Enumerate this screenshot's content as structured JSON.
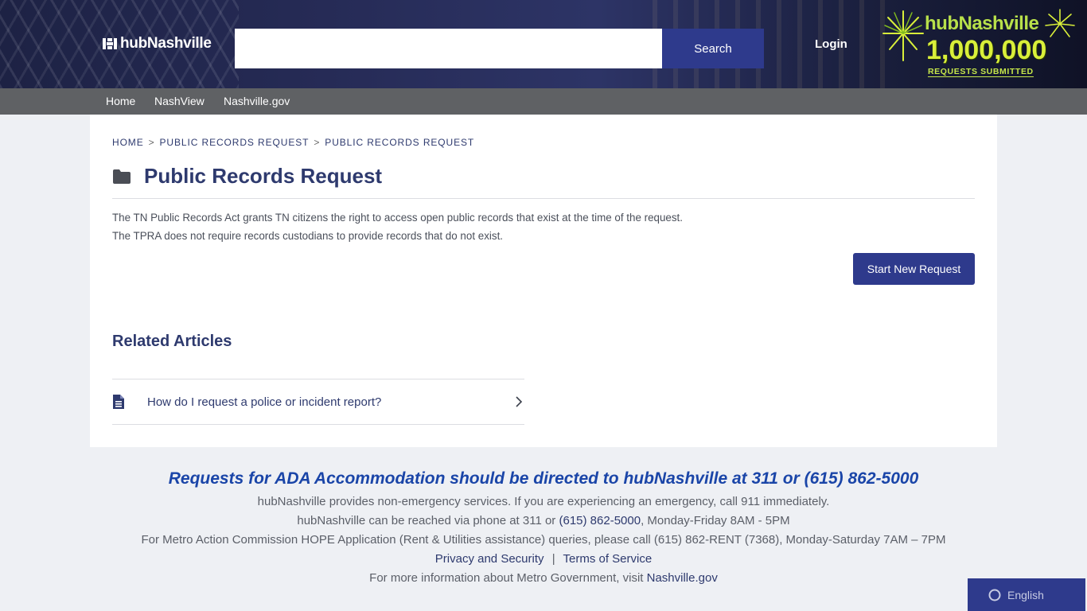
{
  "header": {
    "logo_text": "hubNashville",
    "search_placeholder": "",
    "search_label": "Search",
    "login_label": "Login",
    "badge": {
      "title": "hubNashville",
      "number": "1,000,000",
      "subtitle": "REQUESTS SUBMITTED"
    }
  },
  "nav": {
    "items": [
      {
        "label": "Home"
      },
      {
        "label": "NashView"
      },
      {
        "label": "Nashville.gov"
      }
    ]
  },
  "breadcrumb": {
    "items": [
      "HOME",
      "PUBLIC RECORDS REQUEST",
      "PUBLIC RECORDS REQUEST"
    ],
    "separator": ">"
  },
  "main": {
    "title": "Public Records Request",
    "description": "The TN Public Records Act grants TN citizens the right to access open public records that exist at the time of the request. The TPRA does not require records custodians to provide records that do not exist.",
    "start_button": "Start New Request",
    "related_heading": "Related Articles",
    "articles": [
      {
        "label": "How do I request a police or incident report?"
      }
    ]
  },
  "footer": {
    "headline": "Requests for ADA Accommodation should be directed to hubNashville at 311 or (615) 862-5000",
    "line1": "hubNashville provides non-emergency services. If you are experiencing an emergency, call 911 immediately.",
    "line2_pre": "hubNashville can be reached via phone at 311 or ",
    "line2_link": "(615) 862-5000",
    "line2_post": ", Monday-Friday 8AM - 5PM",
    "line3": "For Metro Action Commission HOPE Application (Rent & Utilities assistance) queries, please call (615) 862-RENT (7368), Monday-Saturday 7AM – 7PM",
    "privacy_label": "Privacy and Security",
    "divider": "|",
    "terms_label": "Terms of Service",
    "line5_pre": "For more information about Metro Government, visit ",
    "line5_link": "Nashville.gov"
  },
  "translate": {
    "label": "English"
  },
  "colors": {
    "brand": "#2e3a8c",
    "title": "#2e3a6e",
    "footer_headline": "#1a45a8",
    "nav_bg": "#5f6164"
  }
}
